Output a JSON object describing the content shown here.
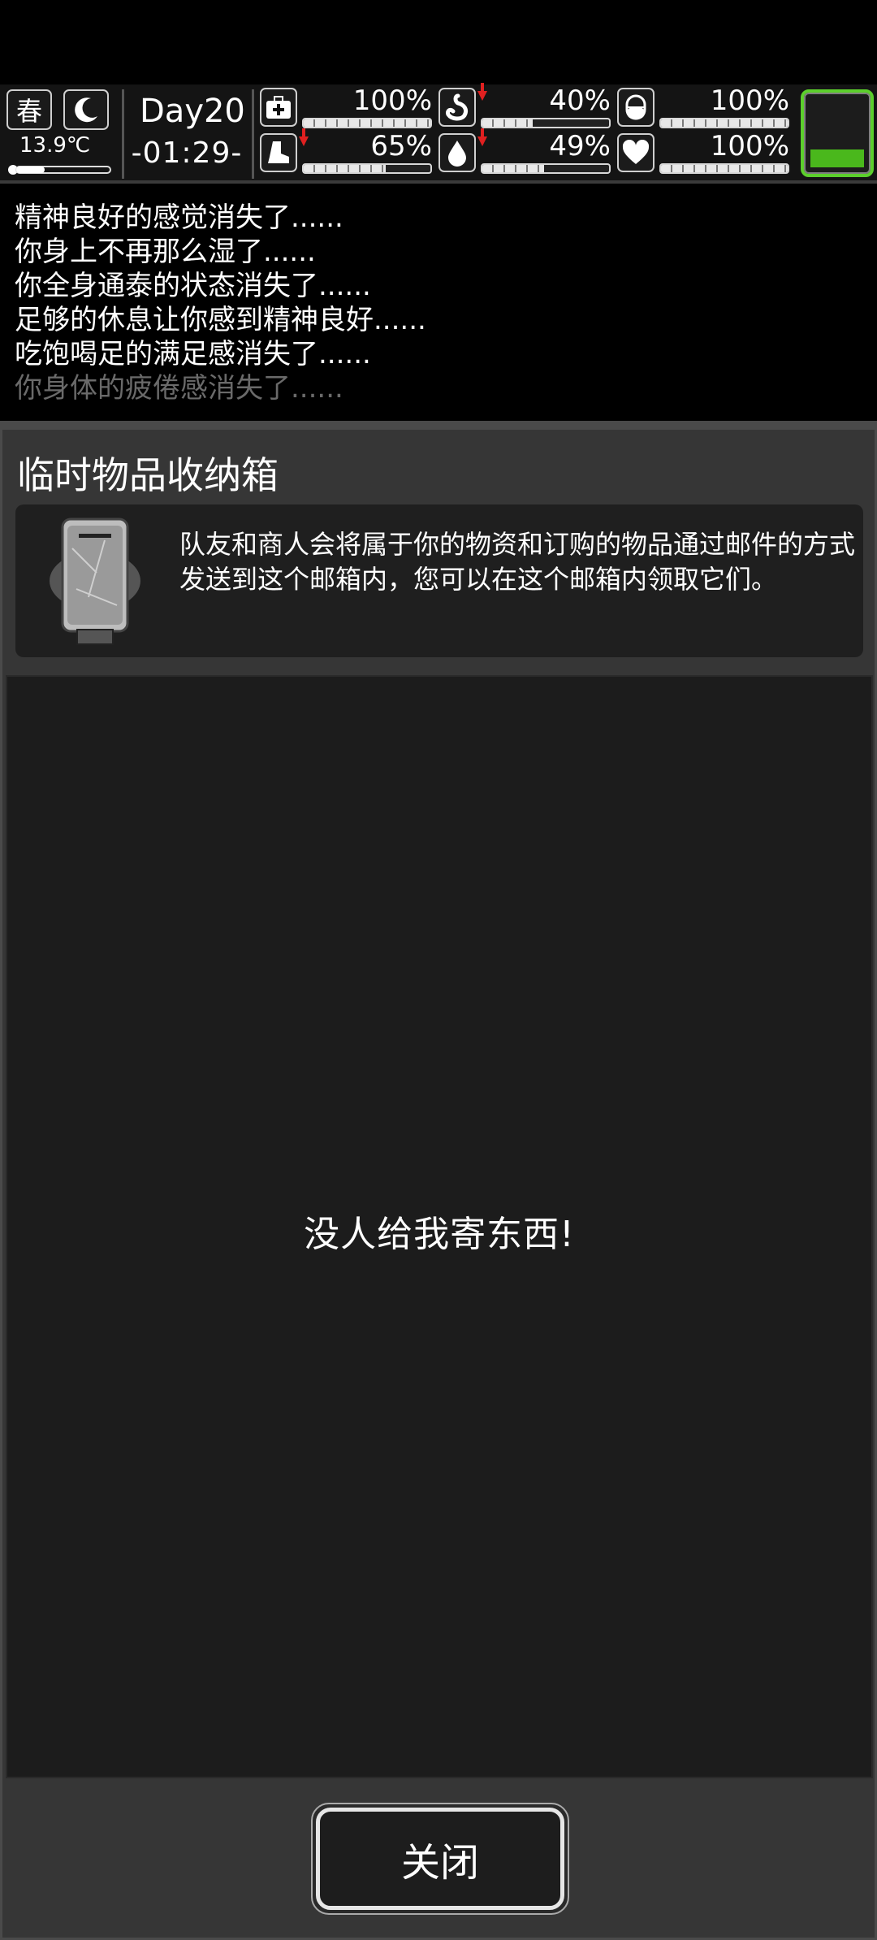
{
  "status": {
    "season": "春",
    "temperature": "13.9℃",
    "temperature_level": 0.3,
    "day": "Day20",
    "time": "-01:29-",
    "battery_level": 0.3,
    "battery_color": "#4ab81c",
    "stats": [
      {
        "name": "health",
        "icon": "medkit-icon",
        "value": "100%",
        "level": 1.0,
        "decreasing": false
      },
      {
        "name": "hunger",
        "icon": "stomach-icon",
        "value": "40%",
        "level": 0.4,
        "decreasing": true
      },
      {
        "name": "medicine",
        "icon": "pill-icon",
        "value": "100%",
        "level": 1.0,
        "decreasing": false
      },
      {
        "name": "stamina",
        "icon": "boot-icon",
        "value": "65%",
        "level": 0.65,
        "decreasing": true
      },
      {
        "name": "thirst",
        "icon": "water-drop-icon",
        "value": "49%",
        "level": 0.49,
        "decreasing": true
      },
      {
        "name": "mood",
        "icon": "heart-icon",
        "value": "100%",
        "level": 1.0,
        "decreasing": false
      }
    ]
  },
  "log": [
    {
      "text": "精神良好的感觉消失了......",
      "color": "#ffffff"
    },
    {
      "text": "你身上不再那么湿了......",
      "color": "#ffffff"
    },
    {
      "text": "你全身通泰的状态消失了......",
      "color": "#ffffff"
    },
    {
      "text": "足够的休息让你感到精神良好......",
      "color": "#ffffff"
    },
    {
      "text": "吃饱喝足的满足感消失了......",
      "color": "#ffffff"
    },
    {
      "text": "你身体的疲倦感消失了......",
      "color": "#6a6a6a"
    }
  ],
  "panel": {
    "title": "临时物品收纳箱",
    "description": "队友和商人会将属于你的物资和订购的物品通过邮件的方式发送到这个邮箱内，您可以在这个邮箱内领取它们。",
    "empty_message": "没人给我寄东西!",
    "close_label": "关闭"
  }
}
